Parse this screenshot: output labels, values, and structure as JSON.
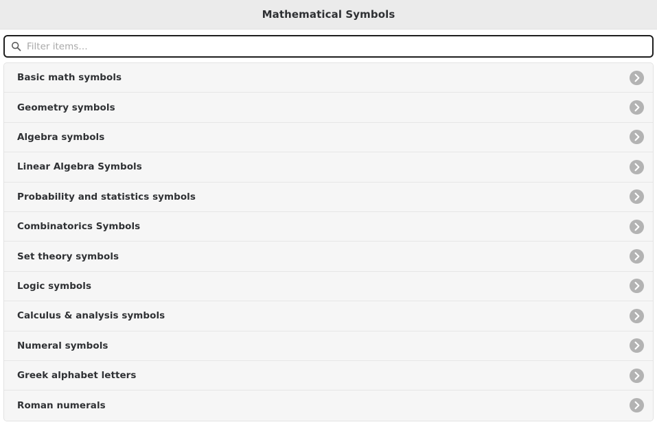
{
  "header": {
    "title": "Mathematical Symbols"
  },
  "search": {
    "icon": "search-icon",
    "placeholder": "Filter items…",
    "value": ""
  },
  "list": {
    "row_icon": "chevron-right-circle-icon",
    "items": [
      {
        "label": "Basic math symbols"
      },
      {
        "label": "Geometry symbols"
      },
      {
        "label": "Algebra symbols"
      },
      {
        "label": "Linear Algebra Symbols"
      },
      {
        "label": "Probability and statistics symbols"
      },
      {
        "label": "Combinatorics Symbols"
      },
      {
        "label": "Set theory symbols"
      },
      {
        "label": "Logic symbols"
      },
      {
        "label": "Calculus & analysis symbols"
      },
      {
        "label": "Numeral symbols"
      },
      {
        "label": "Greek alphabet letters"
      },
      {
        "label": "Roman numerals"
      }
    ]
  },
  "colors": {
    "header_background": "#ebebeb",
    "page_background": "#ffffff",
    "row_background": "#f6f6f6",
    "row_border": "#e6e6e6",
    "text_primary": "#2f3134",
    "placeholder": "#a8a8a8",
    "chevron_circle": "#b3b3b3",
    "search_border": "#1d1d1d"
  }
}
